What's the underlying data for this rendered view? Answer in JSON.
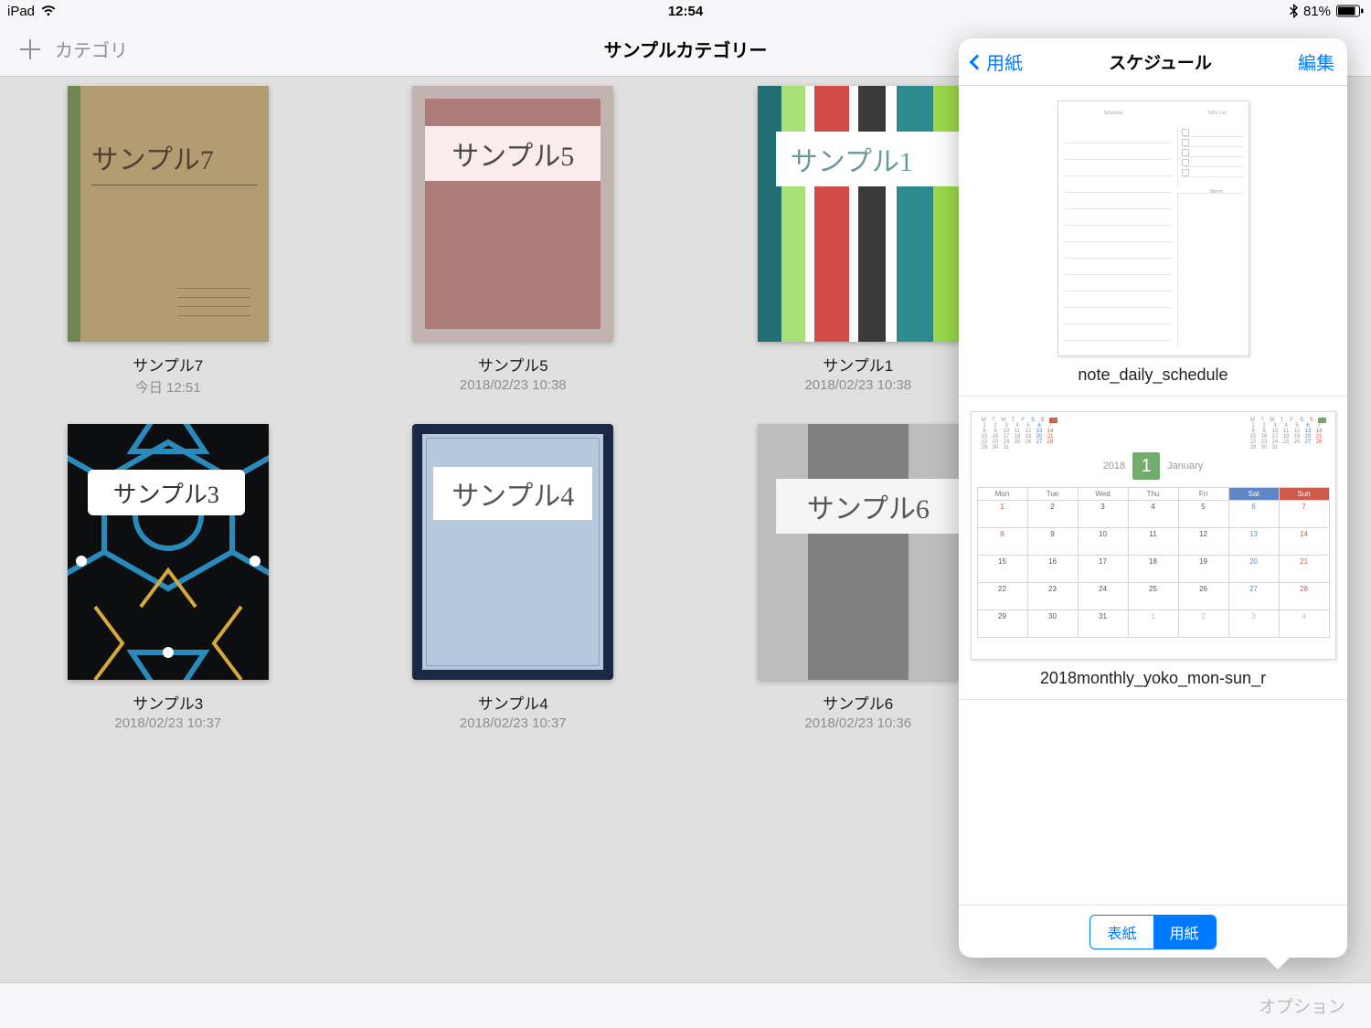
{
  "status": {
    "device": "iPad",
    "time": "12:54",
    "battery": "81%"
  },
  "nav": {
    "category_btn": "カテゴリ",
    "title": "サンプルカテゴリー"
  },
  "bottom": {
    "option": "オプション"
  },
  "notes": [
    {
      "title": "サンプル7",
      "date": "今日 12:51",
      "cover_text": "サンプル7"
    },
    {
      "title": "サンプル5",
      "date": "2018/02/23 10:38",
      "cover_text": "サンプル5"
    },
    {
      "title": "サンプル1",
      "date": "2018/02/23 10:38",
      "cover_text": "サンプル1"
    },
    {
      "title": "サンプル3",
      "date": "2018/02/23 10:37",
      "cover_text": "サンプル3"
    },
    {
      "title": "サンプル4",
      "date": "2018/02/23 10:37",
      "cover_text": "サンプル4"
    },
    {
      "title": "サンプル6",
      "date": "2018/02/23 10:36",
      "cover_text": "サンプル6"
    }
  ],
  "popover": {
    "back": "用紙",
    "title": "スケジュール",
    "edit": "編集",
    "templates": [
      {
        "name": "note_daily_schedule"
      },
      {
        "name": "2018monthly_yoko_mon-sun_r"
      }
    ],
    "daily_labels": {
      "schedule": "Schedule",
      "todo": "ToDo List",
      "memo": "Memo"
    },
    "monthly": {
      "year": "2018",
      "month_num": "1",
      "month_name": "January",
      "weekdays": [
        "Mon",
        "Tue",
        "Wed",
        "Thu",
        "Fri",
        "Sat",
        "Sun"
      ],
      "mini_weekdays": [
        "M",
        "T",
        "W",
        "T",
        "F",
        "S",
        "S"
      ],
      "prev_month": "12",
      "next_month": "2",
      "rows": [
        [
          {
            "d": "1",
            "c": "hol"
          },
          {
            "d": "2"
          },
          {
            "d": "3"
          },
          {
            "d": "4"
          },
          {
            "d": "5"
          },
          {
            "d": "6",
            "c": "sat"
          },
          {
            "d": "7",
            "c": "sun"
          }
        ],
        [
          {
            "d": "8",
            "c": "hol"
          },
          {
            "d": "9"
          },
          {
            "d": "10"
          },
          {
            "d": "11"
          },
          {
            "d": "12"
          },
          {
            "d": "13",
            "c": "sat"
          },
          {
            "d": "14",
            "c": "sun"
          }
        ],
        [
          {
            "d": "15"
          },
          {
            "d": "16"
          },
          {
            "d": "17"
          },
          {
            "d": "18"
          },
          {
            "d": "19"
          },
          {
            "d": "20",
            "c": "sat"
          },
          {
            "d": "21",
            "c": "sun"
          }
        ],
        [
          {
            "d": "22"
          },
          {
            "d": "23"
          },
          {
            "d": "24"
          },
          {
            "d": "25"
          },
          {
            "d": "26"
          },
          {
            "d": "27",
            "c": "sat"
          },
          {
            "d": "28",
            "c": "sun"
          }
        ],
        [
          {
            "d": "29"
          },
          {
            "d": "30"
          },
          {
            "d": "31"
          },
          {
            "d": "1",
            "c": "pm"
          },
          {
            "d": "2",
            "c": "pm"
          },
          {
            "d": "3",
            "c": "pm"
          },
          {
            "d": "4",
            "c": "pm"
          }
        ]
      ]
    },
    "segments": {
      "cover": "表紙",
      "paper": "用紙"
    }
  }
}
